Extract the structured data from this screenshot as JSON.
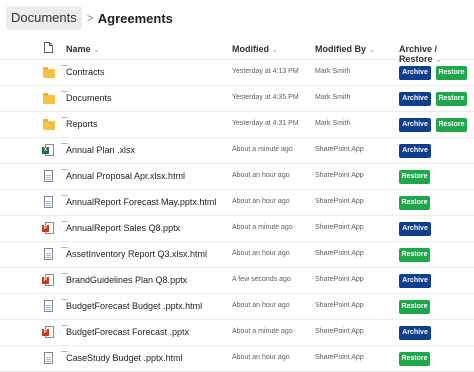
{
  "breadcrumb": {
    "root": "Documents",
    "separator": ">",
    "current": "Agreements"
  },
  "columns": {
    "name": "Name",
    "modified": "Modified",
    "modified_by": "Modified By",
    "actions": "Archive / Restore"
  },
  "buttons": {
    "archive": "Archive",
    "restore": "Restore"
  },
  "colors": {
    "archive": "#0a3f8f",
    "restore": "#1fa84a",
    "folder": "#f5c242"
  },
  "rows": [
    {
      "type": "folder",
      "name": "Contracts",
      "modified": "Yesterday at 4:13 PM",
      "modified_by": "Mark Smith",
      "archive": true,
      "restore": true
    },
    {
      "type": "folder",
      "name": "Documents",
      "modified": "Yesterday at 4:35 PM",
      "modified_by": "Mark Smith",
      "archive": true,
      "restore": true
    },
    {
      "type": "folder",
      "name": "Reports",
      "modified": "Yesterday at 4:31 PM",
      "modified_by": "Mark Smith",
      "archive": true,
      "restore": true
    },
    {
      "type": "xlsx",
      "name": "Annual Plan .xlsx",
      "modified": "About a minute ago",
      "modified_by": "SharePoint App",
      "archive": true,
      "restore": false
    },
    {
      "type": "html",
      "name": "Annual Proposal Apr.xlsx.html",
      "modified": "About an hour ago",
      "modified_by": "SharePoint App",
      "archive": false,
      "restore": true
    },
    {
      "type": "html",
      "name": "AnnualReport Forecast May.pptx.html",
      "modified": "About an hour ago",
      "modified_by": "SharePoint App",
      "archive": false,
      "restore": true
    },
    {
      "type": "pptx",
      "name": "AnnualReport Sales Q8.pptx",
      "modified": "About a minute ago",
      "modified_by": "SharePoint App",
      "archive": true,
      "restore": false
    },
    {
      "type": "html",
      "name": "AssetInventory Report Q3.xlsx.html",
      "modified": "About an hour ago",
      "modified_by": "SharePoint App",
      "archive": false,
      "restore": true
    },
    {
      "type": "pptx",
      "name": "BrandGuidelines Plan Q8.pptx",
      "modified": "A few seconds ago",
      "modified_by": "SharePoint App",
      "archive": true,
      "restore": false
    },
    {
      "type": "html",
      "name": "BudgetForecast Budget .pptx.html",
      "modified": "About an hour ago",
      "modified_by": "SharePoint App",
      "archive": false,
      "restore": true
    },
    {
      "type": "pptx",
      "name": "BudgetForecast Forecast .pptx",
      "modified": "About a minute ago",
      "modified_by": "SharePoint App",
      "archive": true,
      "restore": false
    },
    {
      "type": "html",
      "name": "CaseStudy Budget .pptx.html",
      "modified": "About an hour ago",
      "modified_by": "SharePoint App",
      "archive": false,
      "restore": true
    }
  ]
}
